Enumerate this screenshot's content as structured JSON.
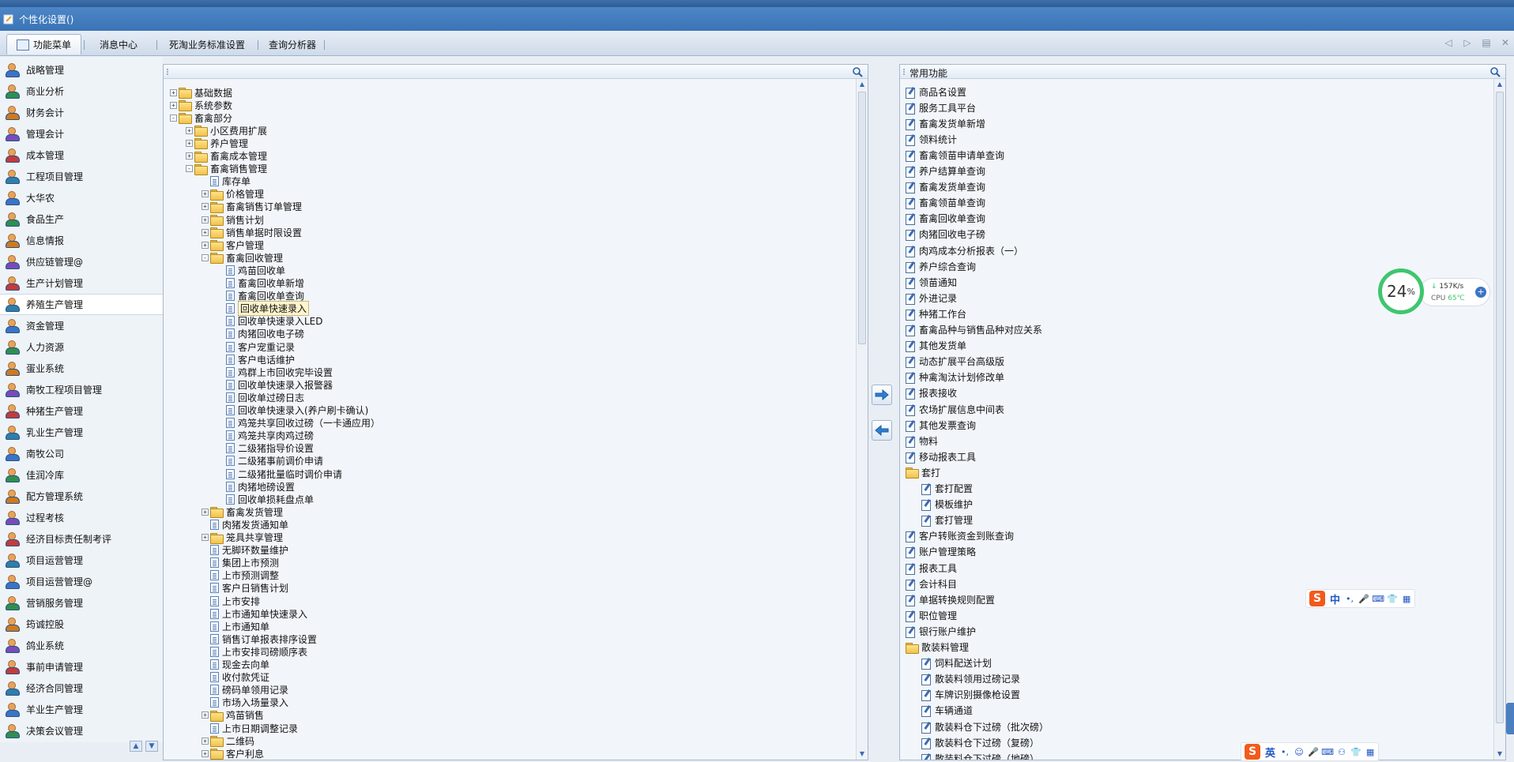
{
  "window": {
    "title": "个性化设置()"
  },
  "tabs": [
    {
      "label": "功能菜单",
      "active": true
    },
    {
      "label": "消息中心"
    },
    {
      "label": "死淘业务标准设置"
    },
    {
      "label": "查询分析器"
    }
  ],
  "sidebar": {
    "items": [
      {
        "label": "战略管理"
      },
      {
        "label": "商业分析"
      },
      {
        "label": "财务会计"
      },
      {
        "label": "管理会计"
      },
      {
        "label": "成本管理"
      },
      {
        "label": "工程项目管理"
      },
      {
        "label": "大华农"
      },
      {
        "label": "食品生产"
      },
      {
        "label": "信息情报"
      },
      {
        "label": "供应链管理@"
      },
      {
        "label": "生产计划管理"
      },
      {
        "label": "养殖生产管理",
        "active": true
      },
      {
        "label": "资金管理"
      },
      {
        "label": "人力资源"
      },
      {
        "label": "蛋业系统"
      },
      {
        "label": "南牧工程项目管理"
      },
      {
        "label": "种猪生产管理"
      },
      {
        "label": "乳业生产管理"
      },
      {
        "label": "南牧公司"
      },
      {
        "label": "佳润冷库"
      },
      {
        "label": "配方管理系统"
      },
      {
        "label": "过程考核"
      },
      {
        "label": "经济目标责任制考评"
      },
      {
        "label": "项目运营管理"
      },
      {
        "label": "项目运营管理@"
      },
      {
        "label": "营销服务管理"
      },
      {
        "label": "筠诚控股"
      },
      {
        "label": "鸽业系统"
      },
      {
        "label": "事前申请管理"
      },
      {
        "label": "经济合同管理"
      },
      {
        "label": "羊业生产管理"
      },
      {
        "label": "决策会议管理"
      }
    ]
  },
  "tree": {
    "rows": [
      {
        "text": "基础数据",
        "type": "folder",
        "level": 0,
        "exp": "+"
      },
      {
        "text": "系统参数",
        "type": "folder",
        "level": 0,
        "exp": "+"
      },
      {
        "text": "畜禽部分",
        "type": "folder",
        "level": 0,
        "exp": "-"
      },
      {
        "text": "小区费用扩展",
        "type": "folder",
        "level": 1,
        "exp": "+"
      },
      {
        "text": "养户管理",
        "type": "folder",
        "level": 1,
        "exp": "+"
      },
      {
        "text": "畜禽成本管理",
        "type": "folder",
        "level": 1,
        "exp": "+"
      },
      {
        "text": "畜禽销售管理",
        "type": "folder",
        "level": 1,
        "exp": "-"
      },
      {
        "text": "库存单",
        "type": "doc",
        "level": 2
      },
      {
        "text": "价格管理",
        "type": "folder",
        "level": 2,
        "exp": "+"
      },
      {
        "text": "畜禽销售订单管理",
        "type": "folder",
        "level": 2,
        "exp": "+"
      },
      {
        "text": "销售计划",
        "type": "folder",
        "level": 2,
        "exp": "+"
      },
      {
        "text": "销售单据时限设置",
        "type": "folder",
        "level": 2,
        "exp": "+"
      },
      {
        "text": "客户管理",
        "type": "folder",
        "level": 2,
        "exp": "+"
      },
      {
        "text": "畜禽回收管理",
        "type": "folder",
        "level": 2,
        "exp": "-"
      },
      {
        "text": "鸡苗回收单",
        "type": "doc",
        "level": 3
      },
      {
        "text": "畜禽回收单新增",
        "type": "doc",
        "level": 3
      },
      {
        "text": "畜禽回收单查询",
        "type": "doc",
        "level": 3
      },
      {
        "text": "回收单快速录入",
        "type": "doc",
        "level": 3,
        "selected": true
      },
      {
        "text": "回收单快速录入LED",
        "type": "doc",
        "level": 3
      },
      {
        "text": "肉猪回收电子磅",
        "type": "doc",
        "level": 3
      },
      {
        "text": "客户宠重记录",
        "type": "doc",
        "level": 3
      },
      {
        "text": "客户电话维护",
        "type": "doc",
        "level": 3
      },
      {
        "text": "鸡群上市回收完毕设置",
        "type": "doc",
        "level": 3
      },
      {
        "text": "回收单快速录入报警器",
        "type": "doc",
        "level": 3
      },
      {
        "text": "回收单过磅日志",
        "type": "doc",
        "level": 3
      },
      {
        "text": "回收单快速录入(养户刷卡确认)",
        "type": "doc",
        "level": 3
      },
      {
        "text": "鸡笼共享回收过磅（一卡通应用）",
        "type": "doc",
        "level": 3
      },
      {
        "text": "鸡笼共享肉鸡过磅",
        "type": "doc",
        "level": 3
      },
      {
        "text": "二级猪指导价设置",
        "type": "doc",
        "level": 3
      },
      {
        "text": "二级猪事前调价申请",
        "type": "doc",
        "level": 3
      },
      {
        "text": "二级猪批量临时调价申请",
        "type": "doc",
        "level": 3
      },
      {
        "text": "肉猪地磅设置",
        "type": "doc",
        "level": 3
      },
      {
        "text": "回收单损耗盘点单",
        "type": "doc",
        "level": 3
      },
      {
        "text": "畜禽发货管理",
        "type": "folder",
        "level": 2,
        "exp": "+"
      },
      {
        "text": "肉猪发货通知单",
        "type": "doc",
        "level": 2
      },
      {
        "text": "笼具共享管理",
        "type": "folder",
        "level": 2,
        "exp": "+"
      },
      {
        "text": "无脚环数量维护",
        "type": "doc",
        "level": 2
      },
      {
        "text": "集团上市预测",
        "type": "doc",
        "level": 2
      },
      {
        "text": "上市预测调整",
        "type": "doc",
        "level": 2
      },
      {
        "text": "客户日销售计划",
        "type": "doc",
        "level": 2
      },
      {
        "text": "上市安排",
        "type": "doc",
        "level": 2
      },
      {
        "text": "上市通知单快速录入",
        "type": "doc",
        "level": 2
      },
      {
        "text": "上市通知单",
        "type": "doc",
        "level": 2
      },
      {
        "text": "销售订单报表排序设置",
        "type": "doc",
        "level": 2
      },
      {
        "text": "上市安排司磅顺序表",
        "type": "doc",
        "level": 2
      },
      {
        "text": "现金去向单",
        "type": "doc",
        "level": 2
      },
      {
        "text": "收付款凭证",
        "type": "doc",
        "level": 2
      },
      {
        "text": "磅码单领用记录",
        "type": "doc",
        "level": 2
      },
      {
        "text": "市场入场量录入",
        "type": "doc",
        "level": 2
      },
      {
        "text": "鸡苗销售",
        "type": "folder",
        "level": 2,
        "exp": "+"
      },
      {
        "text": "上市日期调整记录",
        "type": "doc",
        "level": 2
      },
      {
        "text": "二维码",
        "type": "folder",
        "level": 2,
        "exp": "+"
      },
      {
        "text": "客户利息",
        "type": "folder",
        "level": 2,
        "exp": "+"
      }
    ]
  },
  "favorites": {
    "title": "常用功能",
    "rows": [
      {
        "text": "商品名设置",
        "type": "docpen",
        "level": 0
      },
      {
        "text": "服务工具平台",
        "type": "docpen",
        "level": 0
      },
      {
        "text": "畜禽发货单新增",
        "type": "docpen",
        "level": 0
      },
      {
        "text": "领料统计",
        "type": "docpen",
        "level": 0
      },
      {
        "text": "畜禽领苗申请单查询",
        "type": "docpen",
        "level": 0
      },
      {
        "text": "养户结算单查询",
        "type": "docpen",
        "level": 0
      },
      {
        "text": "畜禽发货单查询",
        "type": "docpen",
        "level": 0
      },
      {
        "text": "畜禽领苗单查询",
        "type": "docpen",
        "level": 0
      },
      {
        "text": "畜禽回收单查询",
        "type": "docpen",
        "level": 0
      },
      {
        "text": "肉猪回收电子磅",
        "type": "docpen",
        "level": 0
      },
      {
        "text": "肉鸡成本分析报表（一）",
        "type": "docpen",
        "level": 0
      },
      {
        "text": "养户综合查询",
        "type": "docpen",
        "level": 0
      },
      {
        "text": "领苗通知",
        "type": "docpen",
        "level": 0
      },
      {
        "text": "外进记录",
        "type": "docpen",
        "level": 0
      },
      {
        "text": "种猪工作台",
        "type": "docpen",
        "level": 0
      },
      {
        "text": "畜禽品种与销售品种对应关系",
        "type": "docpen",
        "level": 0
      },
      {
        "text": "其他发货单",
        "type": "docpen",
        "level": 0
      },
      {
        "text": "动态扩展平台高级版",
        "type": "docpen",
        "level": 0
      },
      {
        "text": "种禽淘汰计划修改单",
        "type": "docpen",
        "level": 0
      },
      {
        "text": "报表接收",
        "type": "docpen",
        "level": 0
      },
      {
        "text": "农场扩展信息中间表",
        "type": "docpen",
        "level": 0
      },
      {
        "text": "其他发票查询",
        "type": "docpen",
        "level": 0
      },
      {
        "text": "物料",
        "type": "docpen",
        "level": 0
      },
      {
        "text": "移动报表工具",
        "type": "docpen",
        "level": 0
      },
      {
        "text": "套打",
        "type": "folder",
        "level": 0
      },
      {
        "text": "套打配置",
        "type": "docpen",
        "level": 1
      },
      {
        "text": "模板维护",
        "type": "docpen",
        "level": 1
      },
      {
        "text": "套打管理",
        "type": "docpen",
        "level": 1
      },
      {
        "text": "客户转账资金到账查询",
        "type": "docpen",
        "level": 0
      },
      {
        "text": "账户管理策略",
        "type": "docpen",
        "level": 0
      },
      {
        "text": "报表工具",
        "type": "docpen",
        "level": 0
      },
      {
        "text": "会计科目",
        "type": "docpen",
        "level": 0
      },
      {
        "text": "单据转换规则配置",
        "type": "docpen",
        "level": 0
      },
      {
        "text": "职位管理",
        "type": "docpen",
        "level": 0
      },
      {
        "text": "银行账户维护",
        "type": "docpen",
        "level": 0
      },
      {
        "text": "散装料管理",
        "type": "folder",
        "level": 0
      },
      {
        "text": "饲料配送计划",
        "type": "docpen",
        "level": 1
      },
      {
        "text": "散装料领用过磅记录",
        "type": "docpen",
        "level": 1
      },
      {
        "text": "车牌识别摄像枪设置",
        "type": "docpen",
        "level": 1
      },
      {
        "text": "车辆通道",
        "type": "docpen",
        "level": 1
      },
      {
        "text": "散装料仓下过磅（批次磅）",
        "type": "docpen",
        "level": 1
      },
      {
        "text": "散装料仓下过磅（复磅）",
        "type": "docpen",
        "level": 1
      },
      {
        "text": "散装料仓下过磅（地磅）",
        "type": "docpen",
        "level": 1
      }
    ]
  },
  "monitor": {
    "percent": "24",
    "percent_unit": "%",
    "net": "157K/s",
    "cpu_label": "CPU",
    "cpu_temp": "65℃"
  },
  "ime1": {
    "logo": "S",
    "mode": "中"
  },
  "ime2": {
    "logo": "S",
    "mode": "英"
  }
}
